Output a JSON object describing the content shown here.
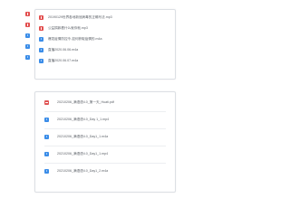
{
  "top_panel": {
    "files": [
      {
        "name": "20190129世界各地新冠病毒的正确写法.mp3",
        "type": "audio",
        "icon": "audio-file-icon"
      },
      {
        "name": "公益捐款看什么就你就.mp3",
        "type": "audio",
        "icon": "audio-file-icon"
      },
      {
        "name": "爆发疫情防控令-如何获取疫情的.m4a",
        "type": "video",
        "icon": "video-file-icon"
      },
      {
        "name": "直播2020.06.06.m4a",
        "type": "video",
        "icon": "video-file-icon"
      },
      {
        "name": "直播2020.06.07.m4a",
        "type": "video",
        "icon": "video-file-icon"
      }
    ]
  },
  "bottom_panel": {
    "files": [
      {
        "name": "20210206_满语语4.0_第一天_Huati.pdf",
        "type": "pdf",
        "icon": "pdf-file-icon"
      },
      {
        "name": "20210206_满语语4.0_Day 1_1.mp4",
        "type": "video",
        "icon": "video-file-icon"
      },
      {
        "name": "20210206_满语语4.0_Day1_1.m4a",
        "type": "video",
        "icon": "video-file-icon"
      },
      {
        "name": "20210206_满语语4.0_Day1_1.mp4",
        "type": "video",
        "icon": "video-file-icon"
      },
      {
        "name": "20210206_满语语4.0_Day1_2.m4a",
        "type": "video",
        "icon": "video-file-icon"
      }
    ]
  },
  "colors": {
    "video_icon": "#3b8de8",
    "audio_icon": "#e24f4f",
    "pdf_icon": "#e05555",
    "label_text": "#5a5f66"
  }
}
